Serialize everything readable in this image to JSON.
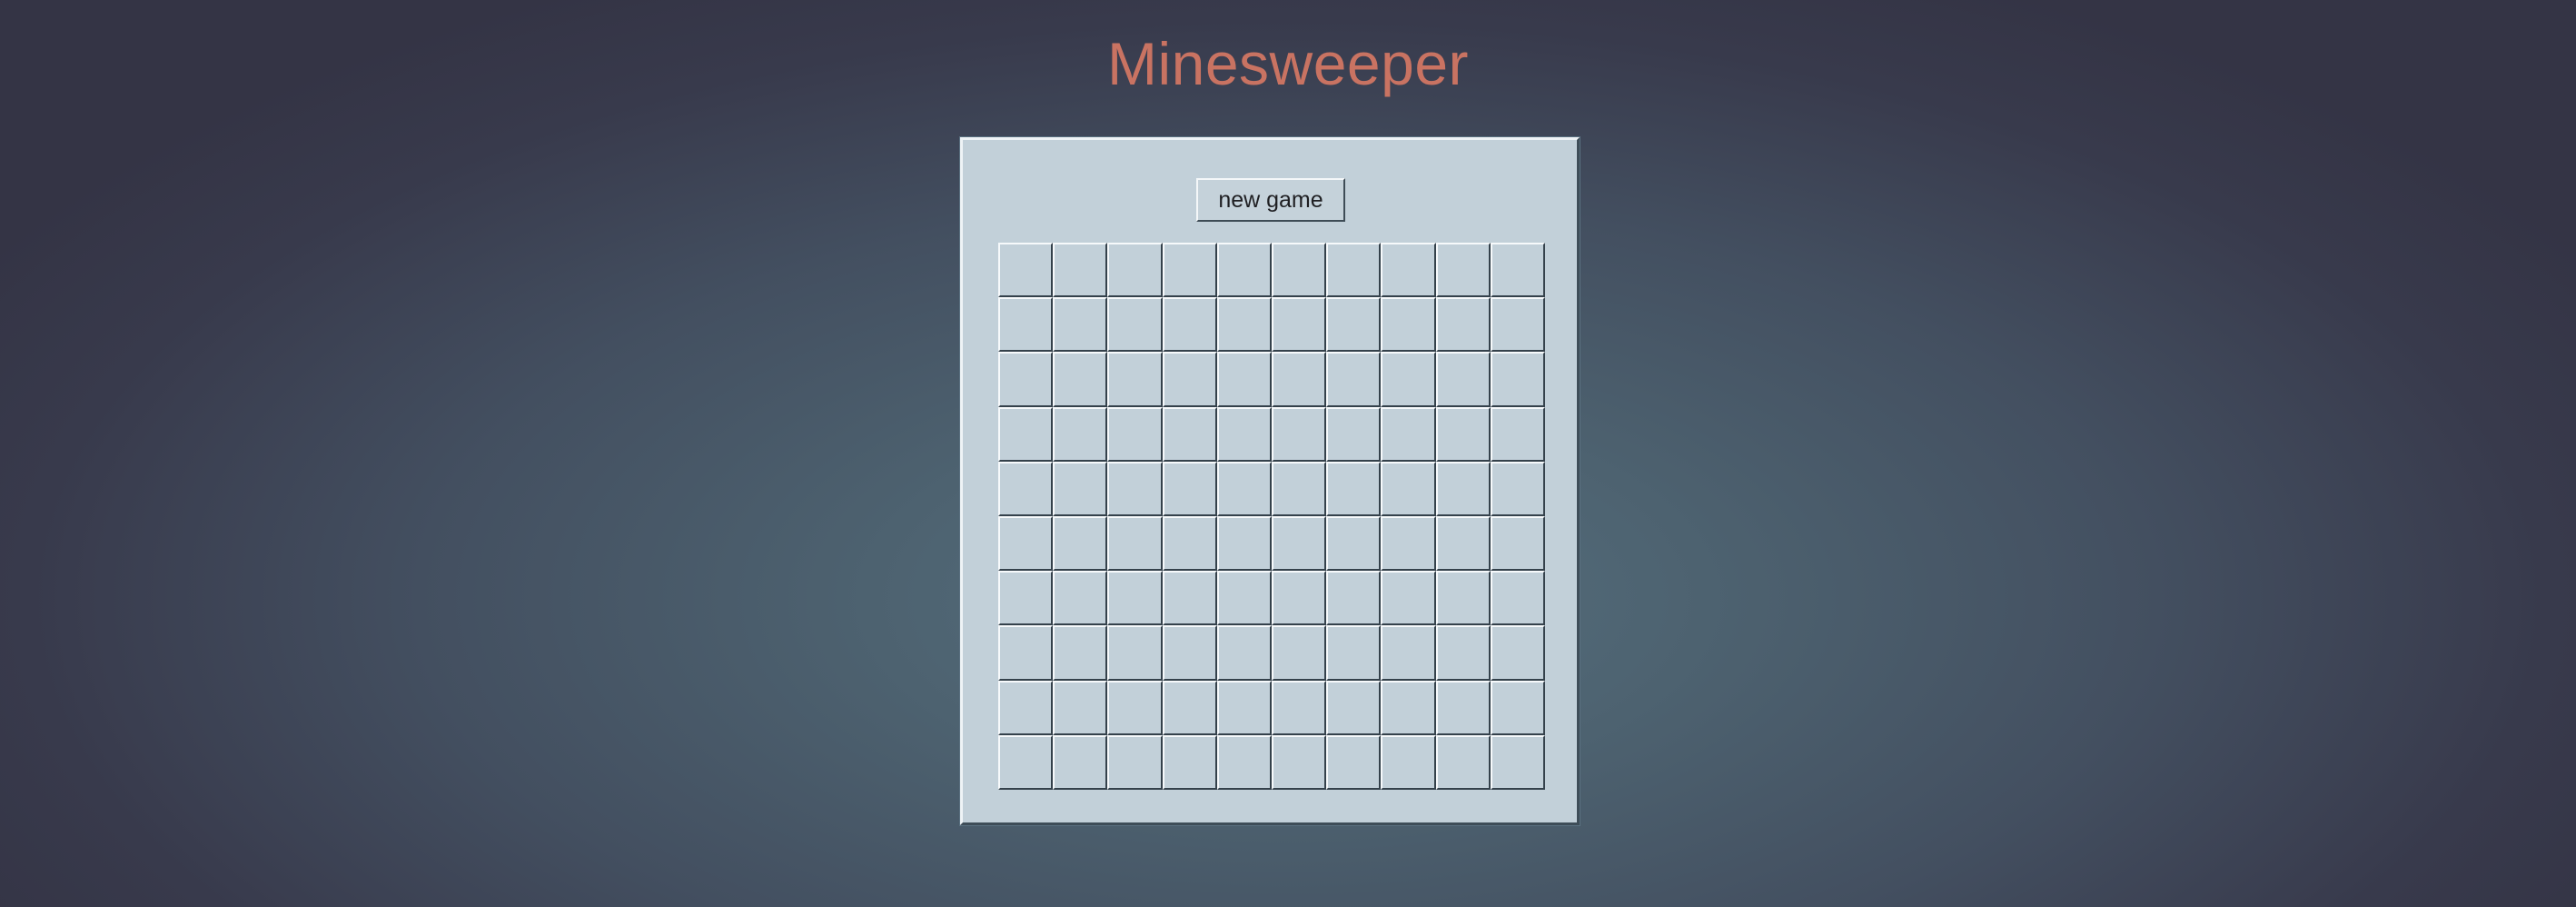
{
  "title": "Minesweeper",
  "colors": {
    "title": "#c97362",
    "panel": "#c2d0d9",
    "cell": "#c2d0d9"
  },
  "controls": {
    "new_game_label": "new game"
  },
  "board": {
    "rows": 10,
    "cols": 10,
    "state": "all cells unrevealed"
  }
}
